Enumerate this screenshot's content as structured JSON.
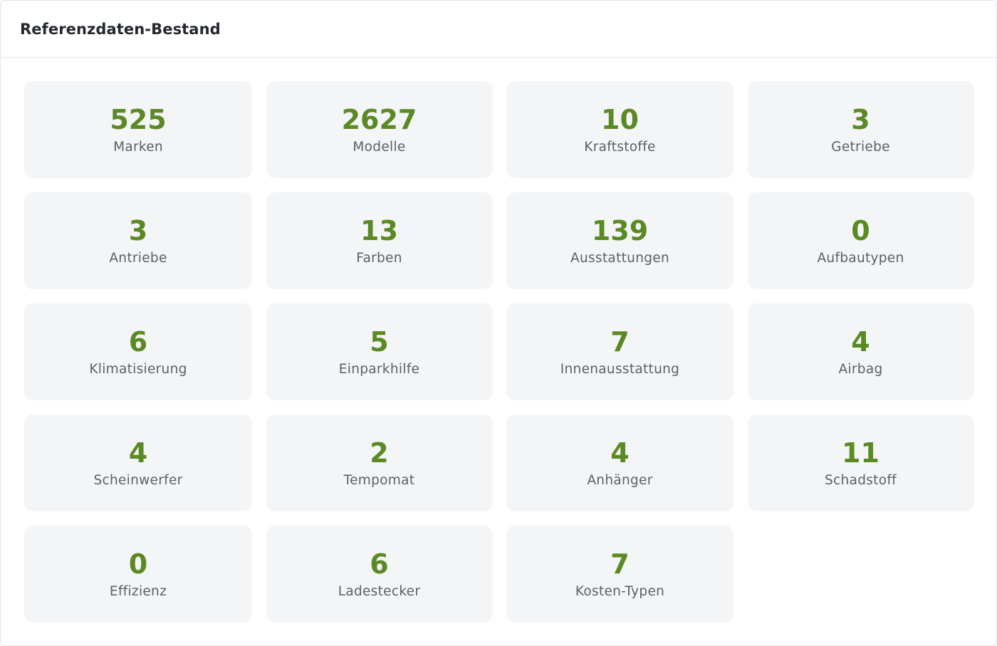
{
  "header": {
    "title": "Referenzdaten-Bestand"
  },
  "stats": [
    {
      "value": "525",
      "label": "Marken"
    },
    {
      "value": "2627",
      "label": "Modelle"
    },
    {
      "value": "10",
      "label": "Kraftstoffe"
    },
    {
      "value": "3",
      "label": "Getriebe"
    },
    {
      "value": "3",
      "label": "Antriebe"
    },
    {
      "value": "13",
      "label": "Farben"
    },
    {
      "value": "139",
      "label": "Ausstattungen"
    },
    {
      "value": "0",
      "label": "Aufbautypen"
    },
    {
      "value": "6",
      "label": "Klimatisierung"
    },
    {
      "value": "5",
      "label": "Einparkhilfe"
    },
    {
      "value": "7",
      "label": "Innenausstattung"
    },
    {
      "value": "4",
      "label": "Airbag"
    },
    {
      "value": "4",
      "label": "Scheinwerfer"
    },
    {
      "value": "2",
      "label": "Tempomat"
    },
    {
      "value": "4",
      "label": "Anhänger"
    },
    {
      "value": "11",
      "label": "Schadstoff"
    },
    {
      "value": "0",
      "label": "Effizienz"
    },
    {
      "value": "6",
      "label": "Ladestecker"
    },
    {
      "value": "7",
      "label": "Kosten-Typen"
    }
  ],
  "colors": {
    "value": "#5a8a23",
    "label": "#5b6068",
    "card_background": "#f4f5f7",
    "border": "#e2e5ea"
  }
}
